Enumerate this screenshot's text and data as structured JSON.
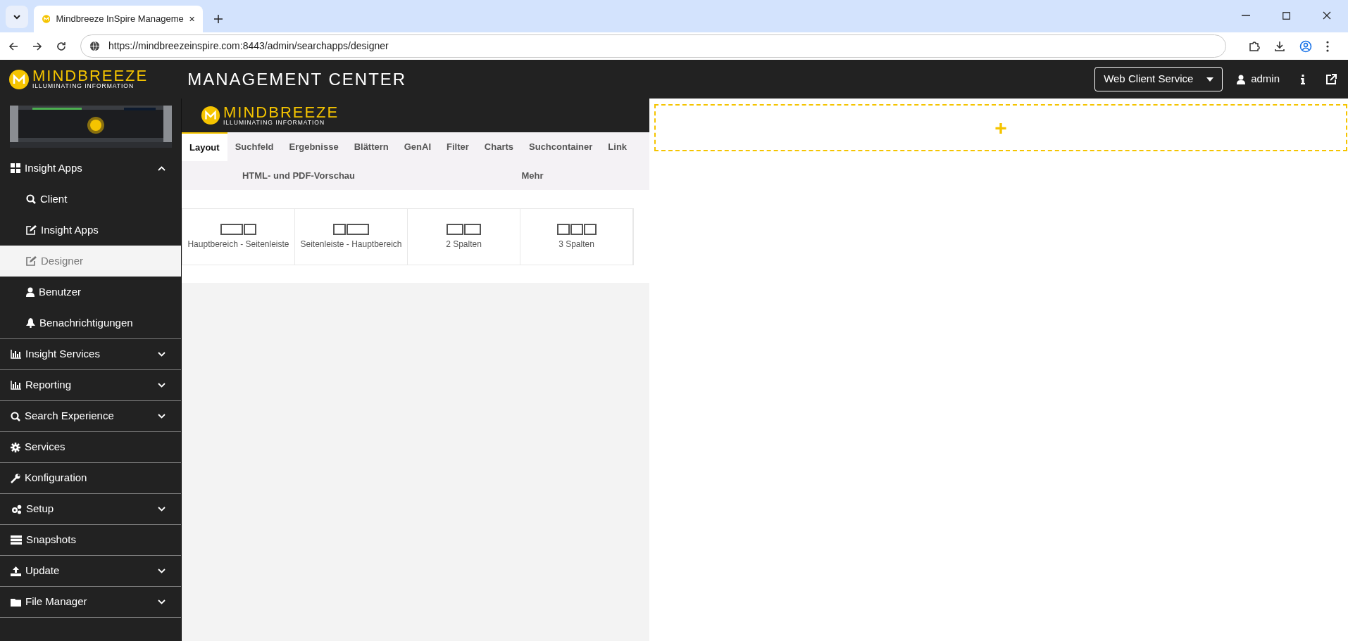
{
  "browser": {
    "tab_title": "Mindbreeze InSpire Manageme",
    "url": "https://mindbreezeinspire.com:8443/admin/searchapps/designer"
  },
  "header": {
    "logo_word": "MINDBREEZE",
    "logo_tagline": "ILLUMINATING INFORMATION",
    "title": "MANAGEMENT CENTER",
    "service_select": "Web Client Service",
    "user": "admin"
  },
  "sidebar": {
    "items": [
      {
        "label": "Insight Apps",
        "kind": "group",
        "expanded": true,
        "children": [
          {
            "label": "Client",
            "selected": false
          },
          {
            "label": "Insight Apps",
            "selected": false
          },
          {
            "label": "Designer",
            "selected": true
          },
          {
            "label": "Benutzer",
            "selected": false
          },
          {
            "label": "Benachrichtigungen",
            "selected": false
          }
        ]
      },
      {
        "label": "Insight Services",
        "kind": "group",
        "expanded": false
      },
      {
        "label": "Reporting",
        "kind": "group",
        "expanded": false
      },
      {
        "label": "Search Experience",
        "kind": "group",
        "expanded": false
      },
      {
        "label": "Services",
        "kind": "link"
      },
      {
        "label": "Konfiguration",
        "kind": "link"
      },
      {
        "label": "Setup",
        "kind": "group",
        "expanded": false
      },
      {
        "label": "Snapshots",
        "kind": "link"
      },
      {
        "label": "Update",
        "kind": "group",
        "expanded": false
      },
      {
        "label": "File Manager",
        "kind": "group",
        "expanded": false
      }
    ]
  },
  "designer": {
    "logo_word": "MINDBREEZE",
    "logo_tagline": "ILLUMINATING INFORMATION",
    "tabs": [
      {
        "label": "Layout",
        "selected": true
      },
      {
        "label": "Suchfeld",
        "selected": false
      },
      {
        "label": "Ergebnisse",
        "selected": false
      },
      {
        "label": "Blättern",
        "selected": false
      },
      {
        "label": "GenAI",
        "selected": false
      },
      {
        "label": "Filter",
        "selected": false
      },
      {
        "label": "Charts",
        "selected": false
      },
      {
        "label": "Suchcontainer",
        "selected": false
      },
      {
        "label": "Link",
        "selected": false
      }
    ],
    "tabs_row_2": [
      {
        "label": "HTML- und PDF-Vorschau",
        "selected": false
      },
      {
        "label": "Mehr",
        "selected": false
      }
    ],
    "layouts": [
      "Hauptbereich - Seitenleiste",
      "Seitenleiste - Hauptbereich",
      "2 Spalten",
      "3 Spalten"
    ],
    "canvas": {
      "add_symbol": "+"
    }
  }
}
